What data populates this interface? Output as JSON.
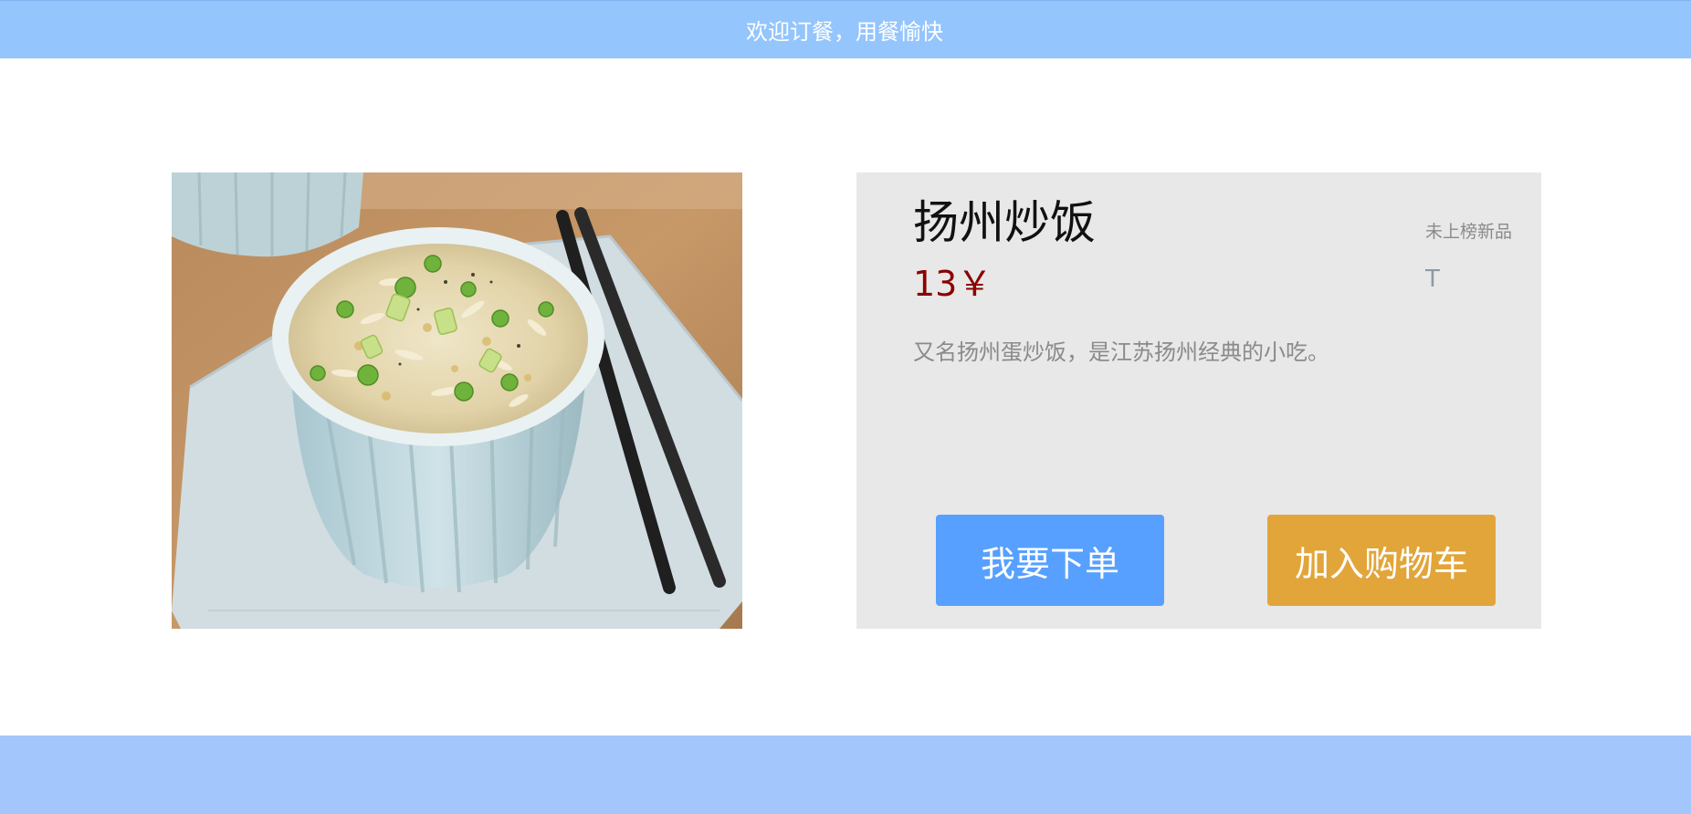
{
  "header": {
    "title": "欢迎订餐，用餐愉快"
  },
  "dish": {
    "image_alt": "fried-rice-bowl-photo",
    "name": "扬州炒饭",
    "price": "13￥",
    "description": "又名扬州蛋炒饭，是江苏扬州经典的小吃。",
    "badge": "未上榜新品",
    "badge_letter": "T"
  },
  "actions": {
    "order_label": "我要下单",
    "cart_label": "加入购物车"
  },
  "colors": {
    "header_bg": "#94c5fd",
    "footer_bg": "#a3c7fd",
    "card_bg": "#e8e8e8",
    "price": "#8b0000",
    "order_button": "#58a0ff",
    "cart_button": "#e2a53a"
  }
}
